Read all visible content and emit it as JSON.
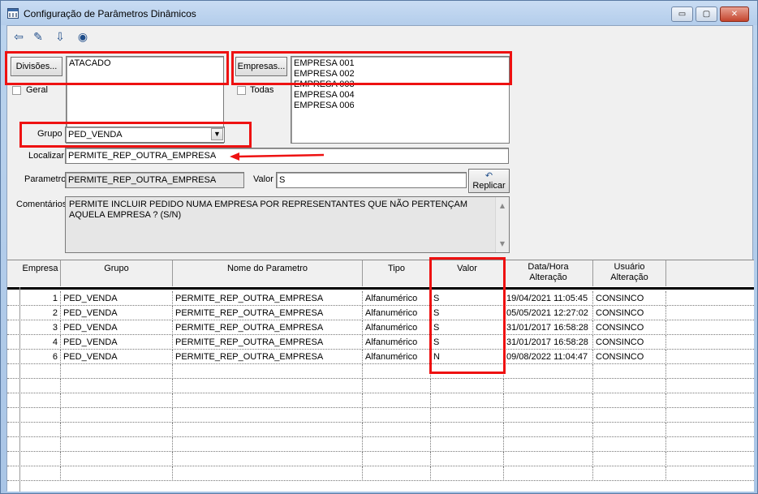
{
  "window": {
    "title": "Configuração de Parâmetros Dinâmicos",
    "controls": {
      "minimize": "▭",
      "maximize": "▢",
      "close": "✕"
    }
  },
  "toolbar": {
    "buttons": [
      {
        "name": "exit-icon",
        "glyph": "⇦"
      },
      {
        "name": "eraser-icon",
        "glyph": "✎"
      },
      {
        "name": "save-download-icon",
        "glyph": "⇩"
      },
      {
        "name": "binoculars-icon",
        "glyph": "◉"
      }
    ]
  },
  "divisoes": {
    "button_label": "Divisões...",
    "items": [
      "ATACADO"
    ],
    "geral_label": "Geral"
  },
  "empresas": {
    "button_label": "Empresas...",
    "items": [
      "EMPRESA 001",
      "EMPRESA 002",
      "EMPRESA 003",
      "EMPRESA 004",
      "EMPRESA 006"
    ],
    "todas_label": "Todas"
  },
  "grupo": {
    "label": "Grupo",
    "value": "PED_VENDA"
  },
  "localizar": {
    "label": "Localizar",
    "value": "PERMITE_REP_OUTRA_EMPRESA"
  },
  "parametro": {
    "label": "Parametro",
    "value": "PERMITE_REP_OUTRA_EMPRESA"
  },
  "valor": {
    "label": "Valor",
    "value": "S"
  },
  "replicar": {
    "label": "Replicar"
  },
  "comentarios": {
    "label": "Comentários",
    "text": "PERMITE INCLUIR PEDIDO NUMA EMPRESA POR REPRESENTANTES QUE NÃO PERTENÇAM AQUELA EMPRESA ? (S/N)"
  },
  "table": {
    "columns": [
      "Empresa",
      "Grupo",
      "Nome do Parametro",
      "Tipo",
      "Valor",
      "Data/Hora Alteração",
      "Usuário Alteração"
    ],
    "rows": [
      [
        "1",
        "PED_VENDA",
        "PERMITE_REP_OUTRA_EMPRESA",
        "Alfanumérico",
        "S",
        "19/04/2021 11:05:45",
        "CONSINCO"
      ],
      [
        "2",
        "PED_VENDA",
        "PERMITE_REP_OUTRA_EMPRESA",
        "Alfanumérico",
        "S",
        "05/05/2021 12:27:02",
        "CONSINCO"
      ],
      [
        "3",
        "PED_VENDA",
        "PERMITE_REP_OUTRA_EMPRESA",
        "Alfanumérico",
        "S",
        "31/01/2017 16:58:28",
        "CONSINCO"
      ],
      [
        "4",
        "PED_VENDA",
        "PERMITE_REP_OUTRA_EMPRESA",
        "Alfanumérico",
        "S",
        "31/01/2017 16:58:28",
        "CONSINCO"
      ],
      [
        "6",
        "PED_VENDA",
        "PERMITE_REP_OUTRA_EMPRESA",
        "Alfanumérico",
        "N",
        "09/08/2022 11:04:47",
        "CONSINCO"
      ]
    ]
  },
  "colors": {
    "highlight": "#ee1111",
    "title_bar": "#b3cdeb"
  }
}
